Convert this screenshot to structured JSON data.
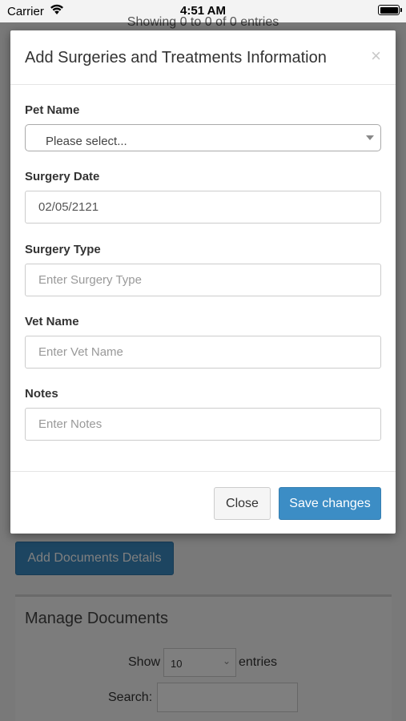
{
  "status_bar": {
    "carrier": "Carrier",
    "time": "4:51 AM"
  },
  "background": {
    "showing_text": "Showing 0 to 0 of 0 entries",
    "add_documents_button": "Add Documents Details",
    "panel_title": "Manage Documents",
    "show_label": "Show",
    "page_size_value": "10",
    "entries_label": "entries",
    "search_label": "Search:"
  },
  "modal": {
    "title": "Add Surgeries and Treatments Information",
    "close_symbol": "×",
    "fields": {
      "pet_name": {
        "label": "Pet Name",
        "value": "Please select..."
      },
      "surgery_date": {
        "label": "Surgery Date",
        "value": "02/05/2121"
      },
      "surgery_type": {
        "label": "Surgery Type",
        "placeholder": "Enter Surgery Type"
      },
      "vet_name": {
        "label": "Vet Name",
        "placeholder": "Enter Vet Name"
      },
      "notes": {
        "label": "Notes",
        "placeholder": "Enter Notes"
      }
    },
    "buttons": {
      "close": "Close",
      "save": "Save changes"
    }
  },
  "colors": {
    "primary": "#3c8dc5",
    "backdrop": "rgba(0,0,0,0.5)"
  },
  "icons": {
    "wifi": "wifi-icon",
    "battery": "battery-icon",
    "close": "close-icon",
    "dropdown": "chevron-down-icon"
  }
}
